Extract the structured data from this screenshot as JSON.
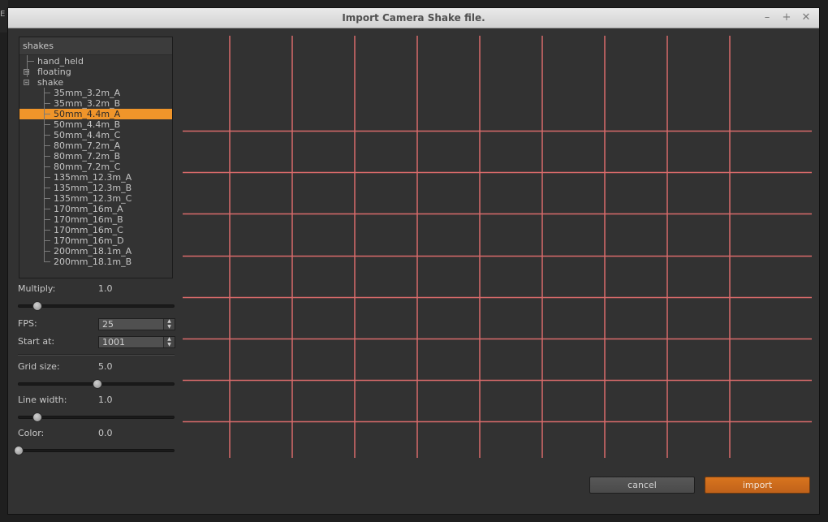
{
  "desktop": {
    "fragment": "E"
  },
  "window": {
    "title": "Import Camera Shake file."
  },
  "title_buttons": {
    "minimize": "–",
    "maximize": "+",
    "close": "✕"
  },
  "tree": {
    "header": "shakes",
    "items": [
      {
        "label": "hand_held",
        "level": 0,
        "toggle": ""
      },
      {
        "label": "floating",
        "level": 0,
        "toggle": "+"
      },
      {
        "label": "shake",
        "level": 0,
        "toggle": "–"
      },
      {
        "label": "35mm_3.2m_A",
        "level": 1
      },
      {
        "label": "35mm_3.2m_B",
        "level": 1
      },
      {
        "label": "50mm_4.4m_A",
        "level": 1,
        "selected": true
      },
      {
        "label": "50mm_4.4m_B",
        "level": 1
      },
      {
        "label": "50mm_4.4m_C",
        "level": 1
      },
      {
        "label": "80mm_7.2m_A",
        "level": 1
      },
      {
        "label": "80mm_7.2m_B",
        "level": 1
      },
      {
        "label": "80mm_7.2m_C",
        "level": 1
      },
      {
        "label": "135mm_12.3m_A",
        "level": 1
      },
      {
        "label": "135mm_12.3m_B",
        "level": 1
      },
      {
        "label": "135mm_12.3m_C",
        "level": 1
      },
      {
        "label": "170mm_16m_A",
        "level": 1
      },
      {
        "label": "170mm_16m_B",
        "level": 1
      },
      {
        "label": "170mm_16m_C",
        "level": 1
      },
      {
        "label": "170mm_16m_D",
        "level": 1
      },
      {
        "label": "200mm_18.1m_A",
        "level": 1
      },
      {
        "label": "200mm_18.1m_B",
        "level": 1
      }
    ]
  },
  "controls": {
    "multiply": {
      "label": "Multiply:",
      "value": "1.0",
      "slider_fraction": 0.12
    },
    "fps": {
      "label": "FPS:",
      "value": "25",
      "up": "▲",
      "down": "▼"
    },
    "start_at": {
      "label": "Start at:",
      "value": "1001",
      "up": "▲",
      "down": "▼"
    },
    "grid_size": {
      "label": "Grid size:",
      "value": "5.0",
      "slider_fraction": 0.5
    },
    "line_width": {
      "label": "Line width:",
      "value": "1.0",
      "slider_fraction": 0.12
    },
    "color": {
      "label": "Color:",
      "value": "0.0",
      "slider_fraction": 0.0
    }
  },
  "grid_preview": {
    "line_color": "#d86a6a",
    "vertical_lines": 9,
    "horizontal_lines": 8
  },
  "buttons": {
    "cancel": "cancel",
    "import": "import"
  },
  "colors": {
    "accent": "#f0952a",
    "import_button": "#c8691c",
    "background": "#323232"
  }
}
